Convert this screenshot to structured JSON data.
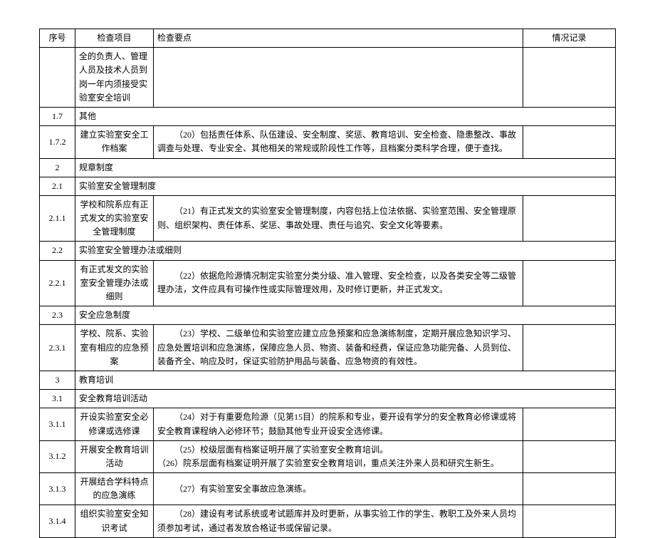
{
  "headers": {
    "seq": "序号",
    "item": "检查项目",
    "point": "检查要点",
    "record": "情况记录"
  },
  "rows": [
    {
      "seq": "",
      "item": "全的负责人、管理人员及技术人员到岗一年内须接受实验室安全培训",
      "point": "",
      "record": "",
      "item_align": "left"
    },
    {
      "seq": "1.7",
      "item": "其他",
      "span": true
    },
    {
      "seq": "1.7.2",
      "item": "建立实验室安全工作档案",
      "point": "（20）包括责任体系、队伍建设、安全制度、奖惩、教育培训、安全检查、隐患整改、事故调查与处理、专业安全、其他相关的常规或阶段性工作等，且档案分类科学合理，便于查找。",
      "record": ""
    },
    {
      "seq": "2",
      "item": "规章制度",
      "span": true
    },
    {
      "seq": "2.1",
      "item": "实验室安全管理制度",
      "span": true
    },
    {
      "seq": "2.1.1",
      "item": "学校和院系应有正式发文的实验室安全管理制度",
      "point": "（21）有正式发文的实验室安全管理制度，内容包括上位法依据、实验室范围、安全管理原则、组织架构、责任体系、奖惩、事故处理、责任与追究、安全文化等要素。",
      "record": ""
    },
    {
      "seq": "2.2",
      "item": "实验室安全管理办法或细则",
      "span": true
    },
    {
      "seq": "2.2.1",
      "item": "有正式发文的实验室安全管理办法或细则",
      "point": "（22）依据危险源情况制定实验室分类分级、准入管理、安全检查，以及各类安全等二级管理办法，文件应具有可操作性或实际管理效用，及时修订更新，并正式发文。",
      "record": ""
    },
    {
      "seq": "2.3",
      "item": "安全应急制度",
      "span": true
    },
    {
      "seq": "2.3.1",
      "item": "学校、院系、实验室有相应的应急预案",
      "point": "（23）学校、二级单位和实验室应建立应急预案和应急演练制度，定期开展应急知识学习、应急处置培训和应急演练，保障应急人员、物资、装备和经费，保证应急功能完备、人员到位、装备齐全、响应及时，保证实验防护用品与装备、应急物资的有效性。",
      "record": ""
    },
    {
      "seq": "3",
      "item": "教育培训",
      "span": true
    },
    {
      "seq": "3.1",
      "item": "安全教育培训活动",
      "span": true
    },
    {
      "seq": "3.1.1",
      "item": "开设实验室安全必修课或选修课",
      "point": "（24）对于有重要危险源（见第15目）的院系和专业，要开设有学分的安全教育必修课或将安全教育课程纳入必修环节；鼓励其他专业开设安全选修课。",
      "record": ""
    },
    {
      "seq": "3.1.2",
      "item": "开展安全教育培训活动",
      "point": "（25）校级层面有档案证明开展了实验室安全教育培训。\n（26）院系层面有档案证明开展了实验室安全教育培训，重点关注外来人员和研究生新生。",
      "record": ""
    },
    {
      "seq": "3.1.3",
      "item": "开展结合学科特点的应急演练",
      "point": "（27）有实验室安全事故应急演练。",
      "record": ""
    },
    {
      "seq": "3.1.4",
      "item": "组织实验室安全知识考试",
      "point": "（28）建设有考试系统或考试题库并及时更新，从事实验工作的学生、教职工及外来人员均须参加考试，通过者发放合格证书或保留记录。",
      "record": ""
    }
  ]
}
